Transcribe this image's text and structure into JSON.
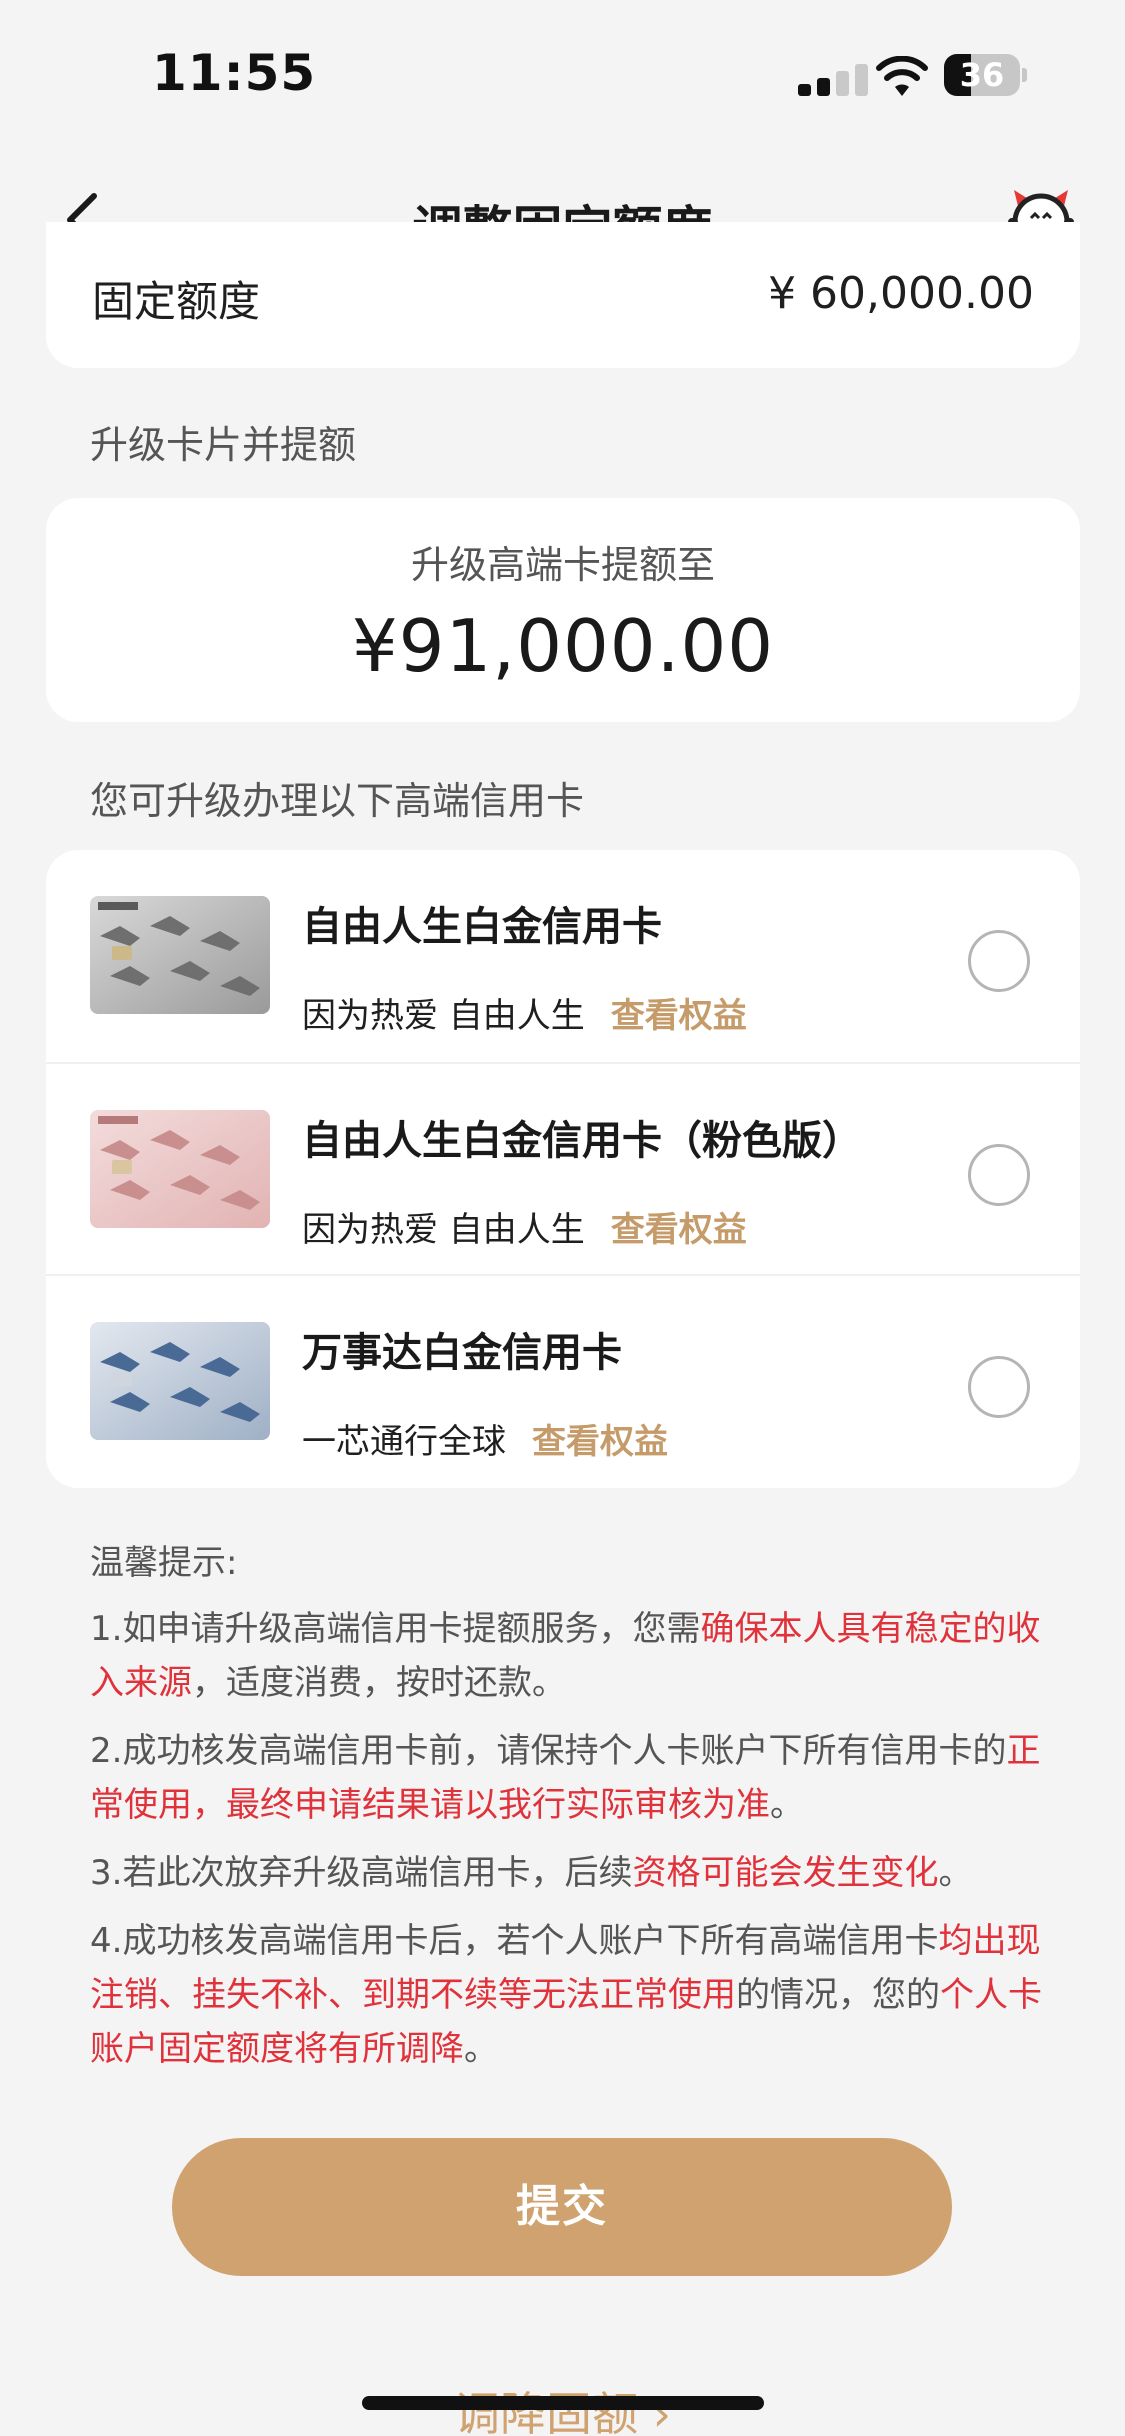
{
  "status_bar": {
    "time": "11:55",
    "battery": "36",
    "battery_level": 0.36
  },
  "nav": {
    "title": "调整固定额度"
  },
  "fixed_limit": {
    "label": "固定额度",
    "value": "¥ 60,000.00"
  },
  "upgrade_section": {
    "title": "升级卡片并提额",
    "subtitle": "升级高端卡提额至",
    "amount": "¥91,000.00"
  },
  "cards_section": {
    "title": "您可升级办理以下高端信用卡",
    "cards": [
      {
        "name": "自由人生白金信用卡",
        "slogan": "因为热爱 自由人生",
        "link": "查看权益",
        "selected": false
      },
      {
        "name": "自由人生白金信用卡（粉色版）",
        "slogan": "因为热爱 自由人生",
        "link": "查看权益",
        "selected": false
      },
      {
        "name": "万事达白金信用卡",
        "slogan": "一芯通行全球",
        "link": "查看权益",
        "selected": false
      }
    ]
  },
  "tips": {
    "title": "温馨提示:",
    "items": [
      {
        "a": "1.如申请升级高端信用卡提额服务，您需",
        "b": "确保本人具有稳定的收入来源",
        "c": "，适度消费，按时还款。"
      },
      {
        "a": "2.成功核发高端信用卡前，请保持个人卡账户下所有信用卡的",
        "b": "正常使用，最终申请结果请以我行实际审核为准",
        "c": "。"
      },
      {
        "a": "3.若此次放弃升级高端信用卡，后续",
        "b": "资格可能会发生变化",
        "c": "。"
      },
      {
        "a": "4.成功核发高端信用卡后，若个人账户下所有高端信用卡",
        "b": "均出现注销、挂失不补、到期不续等无法正常使用",
        "c": "的情况，您的",
        "d": "个人卡账户固定额度将有所调降",
        "e": "。"
      }
    ]
  },
  "buttons": {
    "submit": "提交",
    "reduce": "调降固额 ›"
  },
  "colors": {
    "accent": "#cfa26f",
    "link": "#c59b6a",
    "warning": "#e0323b",
    "background": "#f4f4f4"
  }
}
